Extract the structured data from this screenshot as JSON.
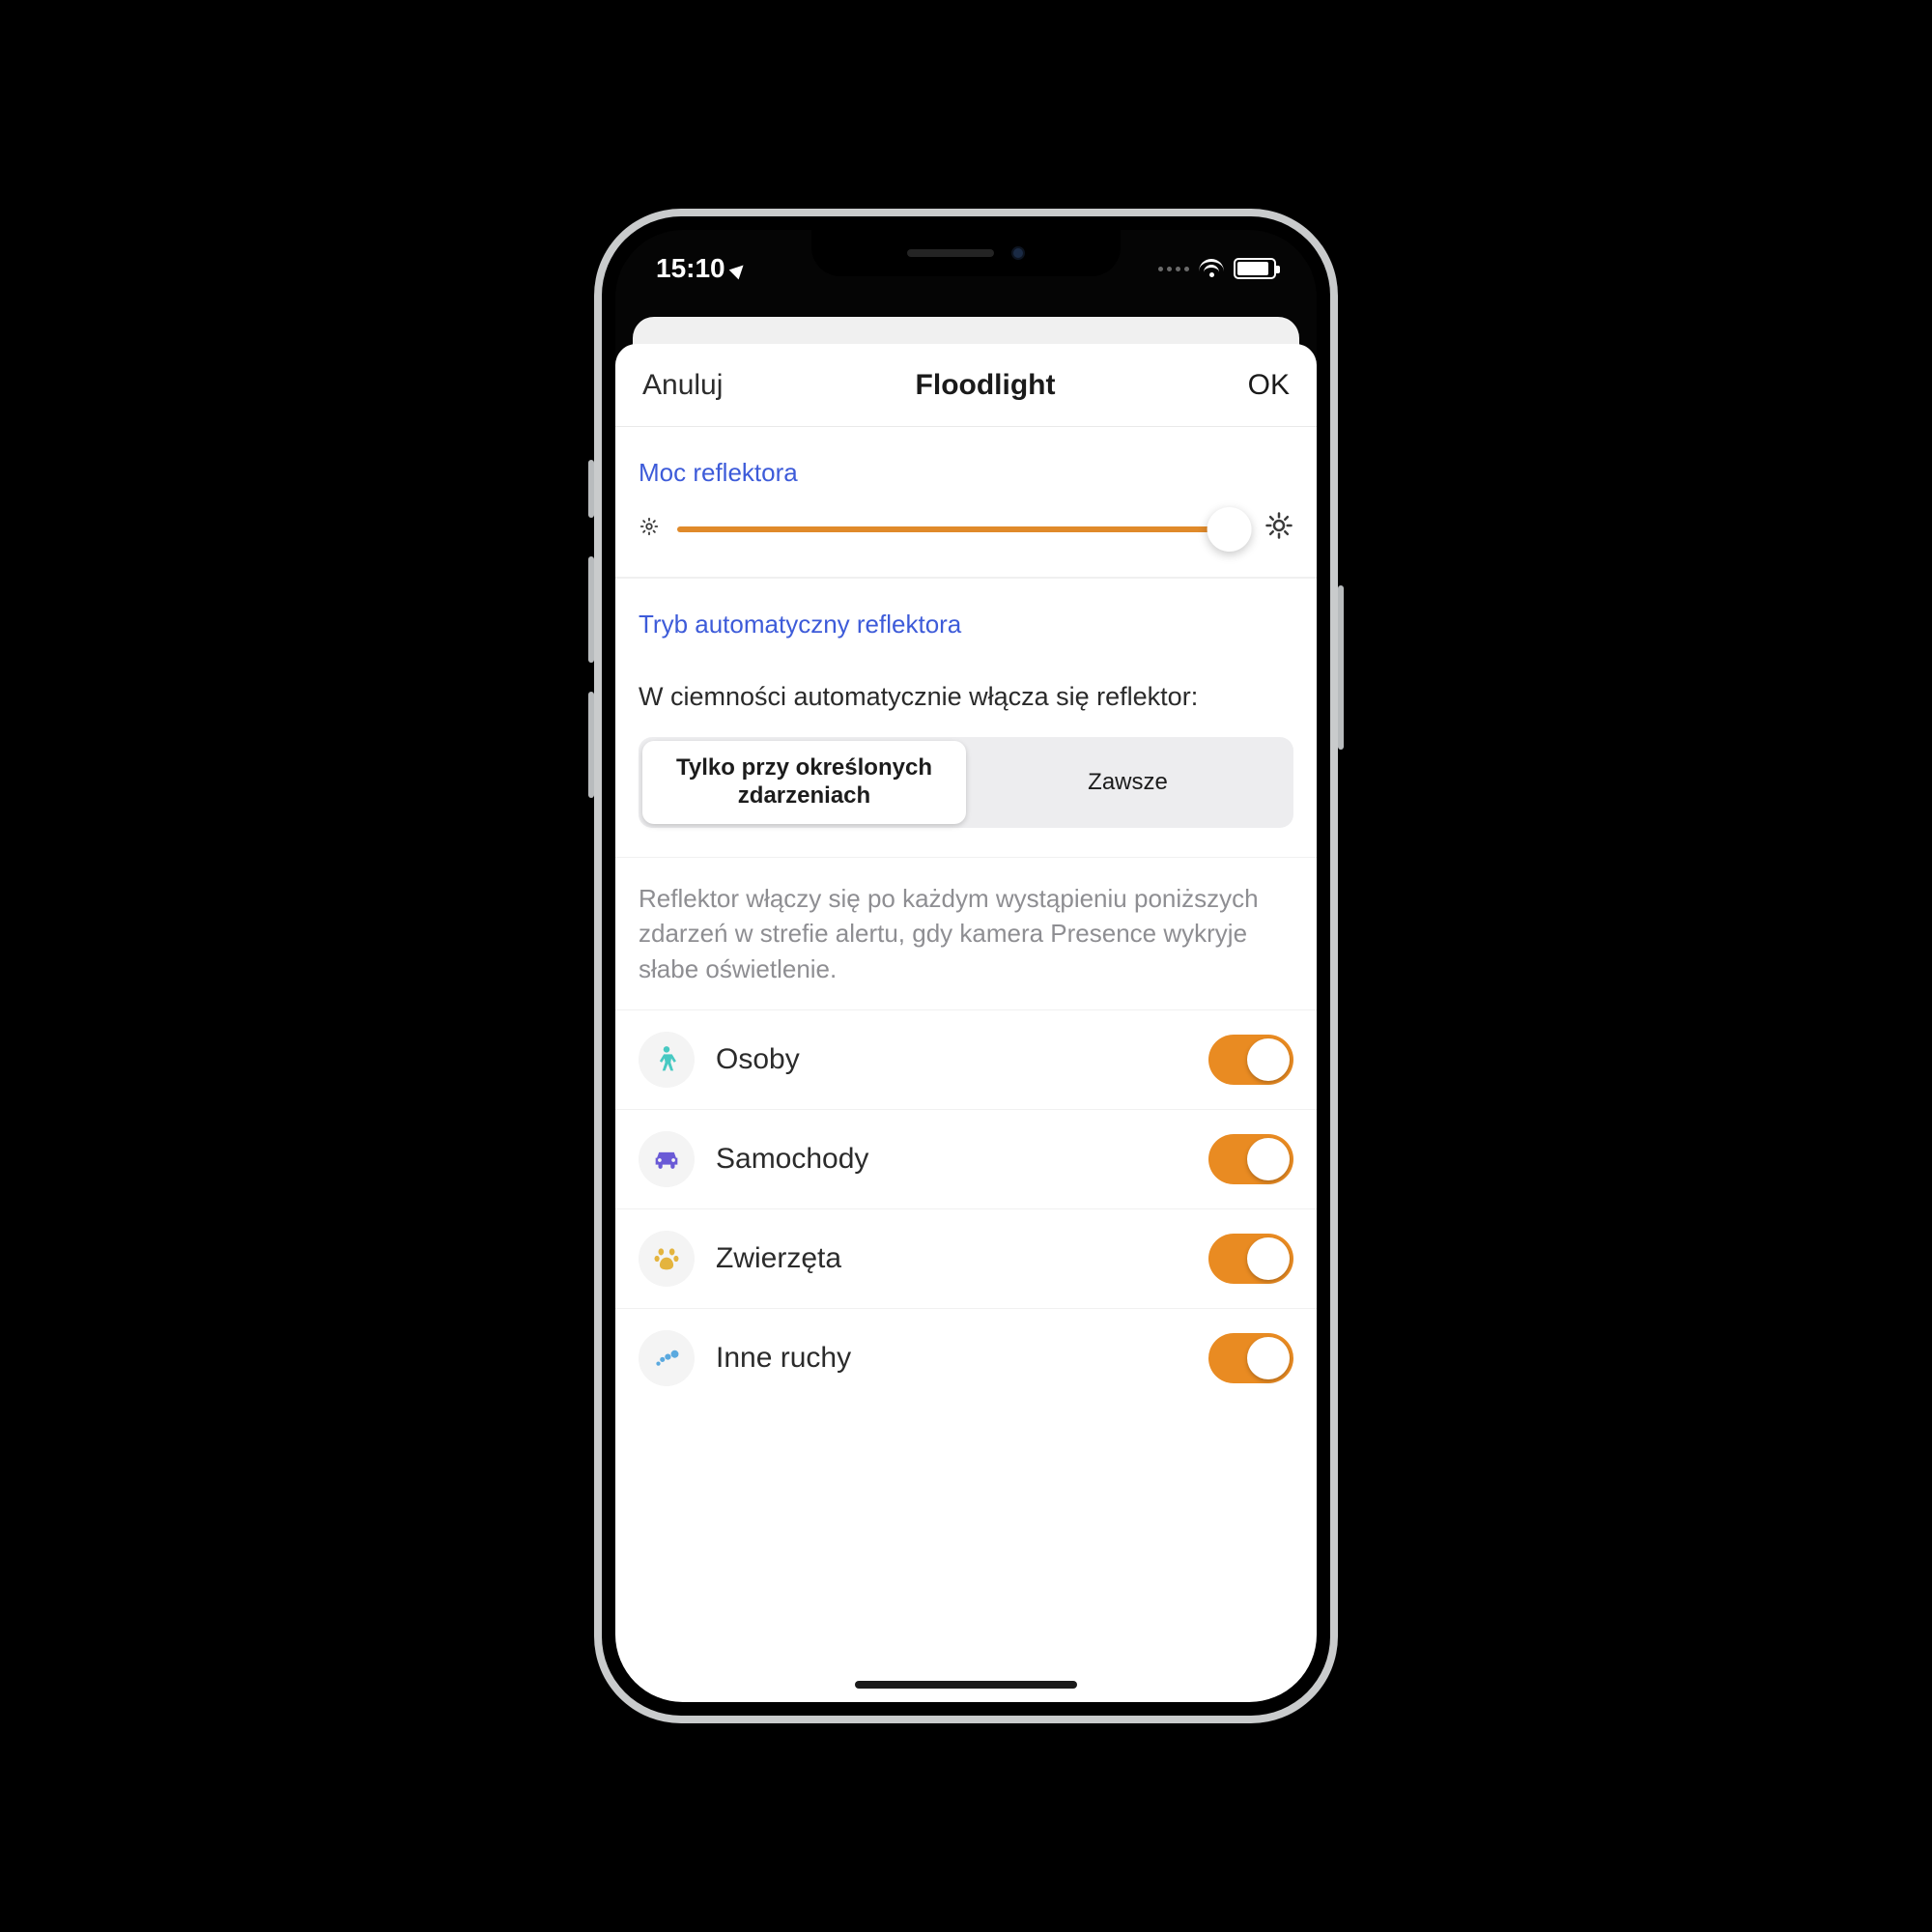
{
  "status": {
    "time": "15:10"
  },
  "nav": {
    "cancel": "Anuluj",
    "title": "Floodlight",
    "ok": "OK"
  },
  "power": {
    "label": "Moc reflektora",
    "value_percent": 96
  },
  "auto_mode": {
    "label": "Tryb automatyczny reflektora",
    "intro": "W ciemności automatycznie włącza się reflektor:",
    "segments": {
      "events": "Tylko przy określonych zdarzeniach",
      "always": "Zawsze"
    },
    "selected": "events",
    "description": "Reflektor włączy się po każdym wystąpieniu poniższych zdarzeń w strefie alertu, gdy kamera Presence wykryje słabe oświetlenie."
  },
  "triggers": {
    "people": {
      "label": "Osoby",
      "on": true,
      "icon_color": "#47c9c2"
    },
    "cars": {
      "label": "Samochody",
      "on": true,
      "icon_color": "#6a5ad6"
    },
    "animals": {
      "label": "Zwierzęta",
      "on": true,
      "icon_color": "#e4b43e"
    },
    "other": {
      "label": "Inne ruchy",
      "on": true,
      "icon_color": "#5aa9df"
    }
  },
  "colors": {
    "accent": "#e98b22",
    "link": "#3d5bd9"
  }
}
